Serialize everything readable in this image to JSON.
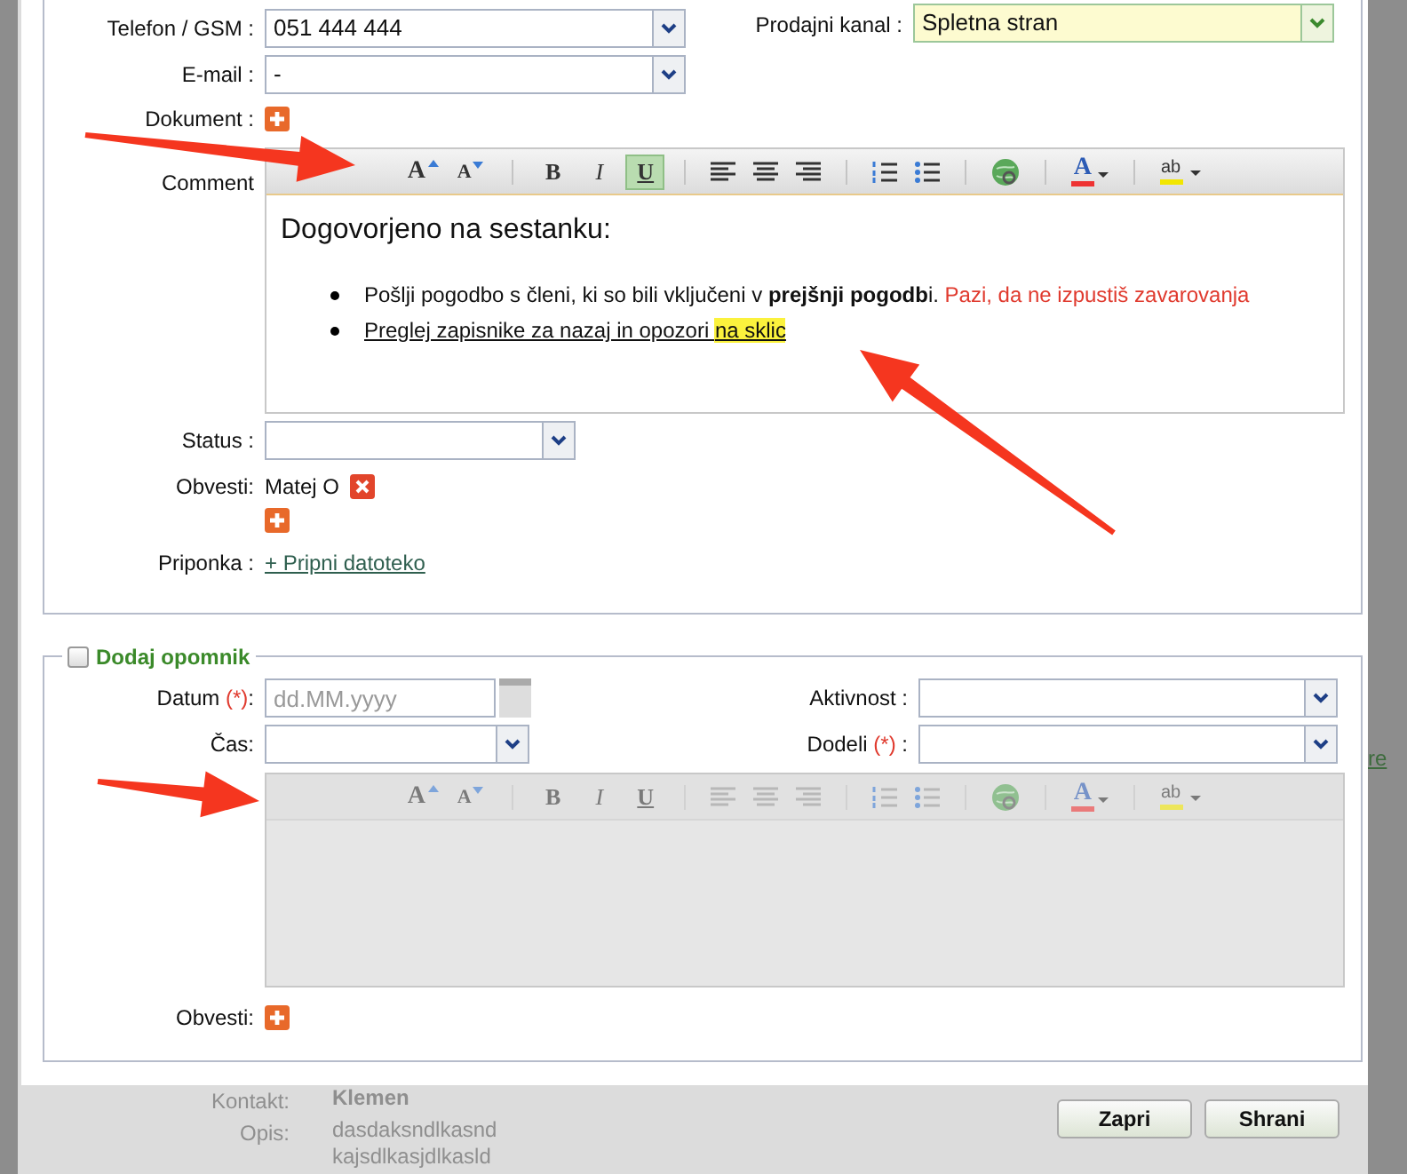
{
  "contact": {
    "phone": {
      "label": "Telefon / GSM :",
      "value": "051 444 444"
    },
    "email": {
      "label": "E-mail :",
      "value": "-"
    },
    "document": {
      "label": "Dokument :"
    },
    "channel": {
      "label": "Prodajni kanal :",
      "value": "Spletna stran"
    },
    "comment": {
      "label": "Comment",
      "toolbar": [
        [
          {
            "kind": "grow",
            "label": "A"
          },
          {
            "kind": "shrink",
            "label": "A"
          }
        ],
        [
          {
            "kind": "bold",
            "label": "B",
            "selected": false
          },
          {
            "kind": "italic",
            "label": "I",
            "selected": false
          },
          {
            "kind": "underline",
            "label": "U",
            "selected": true
          }
        ],
        [
          {
            "kind": "align-left"
          },
          {
            "kind": "align-center"
          },
          {
            "kind": "align-right"
          }
        ],
        [
          {
            "kind": "ol"
          },
          {
            "kind": "ul"
          }
        ],
        [
          {
            "kind": "link"
          }
        ],
        [
          {
            "kind": "font-color",
            "label": "A"
          }
        ],
        [
          {
            "kind": "highlight",
            "label": "ab"
          }
        ]
      ],
      "heading": "Dogovorjeno na sestanku:",
      "bullets": [
        [
          {
            "kind": "normal",
            "text": "Pošlji pogodbo s členi, ki so bili vključeni v **prejšnji pogodb**i. "
          },
          {
            "kind": "warning",
            "text": "Pazi, da ne izpustiš zavarovanja"
          }
        ],
        [
          {
            "kind": "underlined",
            "text": "Preglej zapisnike za nazaj in opozori "
          },
          {
            "kind": "highlighted",
            "text": "na sklic"
          }
        ]
      ]
    },
    "status": {
      "label": "Status :"
    },
    "notify": {
      "label": "Obvesti:",
      "people": [
        "Matej O"
      ]
    },
    "attachment": {
      "label": "Priponka :",
      "link": "+ Pripni datoteko"
    }
  },
  "reminder": {
    "title": "Dodaj opomnik",
    "checked": false,
    "date": {
      "label": "Datum",
      "required": "(*)",
      "suffix": ":",
      "placeholder": "dd.MM.yyyy"
    },
    "time": {
      "label": "Čas:"
    },
    "activity": {
      "label": "Aktivnost :"
    },
    "assign": {
      "label": "Dodeli",
      "required": "(*)",
      "suffix": " :"
    },
    "editor": {
      "disabled": true,
      "toolbar": [
        [
          {
            "kind": "grow",
            "label": "A"
          },
          {
            "kind": "shrink",
            "label": "A"
          }
        ],
        [
          {
            "kind": "bold",
            "label": "B",
            "selected": false
          },
          {
            "kind": "italic",
            "label": "I",
            "selected": false
          },
          {
            "kind": "underline",
            "label": "U",
            "selected": false
          }
        ],
        [
          {
            "kind": "align-left"
          },
          {
            "kind": "align-center"
          },
          {
            "kind": "align-right"
          }
        ],
        [
          {
            "kind": "ol"
          },
          {
            "kind": "ul"
          }
        ],
        [
          {
            "kind": "link"
          }
        ],
        [
          {
            "kind": "font-color",
            "label": "A"
          }
        ],
        [
          {
            "kind": "highlight",
            "label": "ab"
          }
        ]
      ]
    },
    "notify": {
      "label": "Obvesti:"
    }
  },
  "background": {
    "fields": [
      {
        "label": "Kontakt:",
        "value": "Klemen",
        "bold": true
      },
      {
        "label": "Opis:",
        "value": "dasdaksndlkasnd\nkajsdlkasjdlkasld",
        "bold": false
      }
    ],
    "side_link": "re"
  },
  "buttons": [
    "Zapri",
    "Shrani"
  ]
}
